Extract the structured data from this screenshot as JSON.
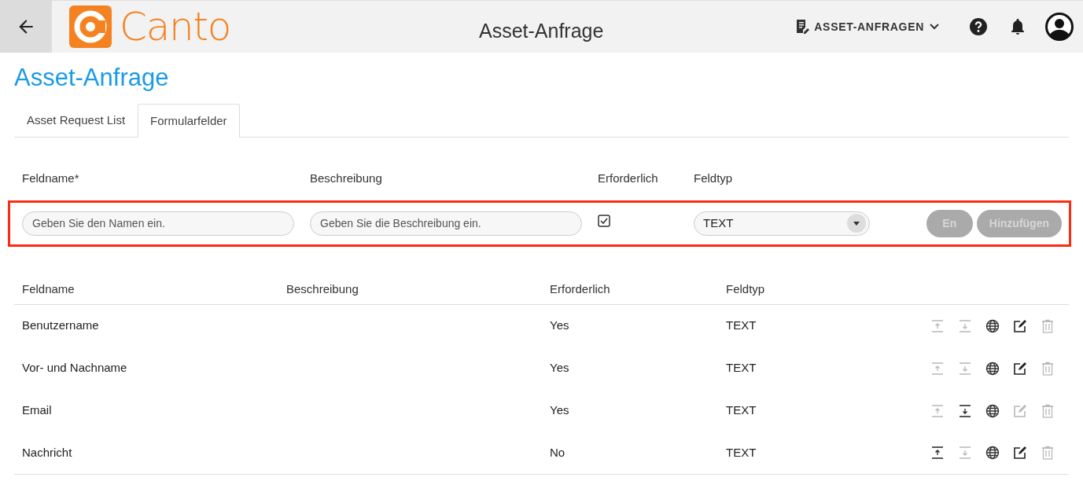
{
  "header": {
    "logo_text": "Canto",
    "title": "Asset-Anfrage",
    "menu_label": "ASSET-ANFRAGEN"
  },
  "page_title": "Asset-Anfrage",
  "tabs": [
    {
      "label": "Asset Request List",
      "selected": false
    },
    {
      "label": "Formularfelder",
      "selected": true
    }
  ],
  "form": {
    "labels": [
      "Feldname*",
      "Beschreibung",
      "Erforderlich",
      "Feldtyp"
    ],
    "name_placeholder": "Geben Sie den Namen ein.",
    "description_placeholder": "Geben Sie die Beschreibung ein.",
    "required_checked": true,
    "type_value": "TEXT",
    "buttons": [
      {
        "label": "En",
        "disabled": true
      },
      {
        "label": "Hinzufügen",
        "disabled": true
      }
    ]
  },
  "table": {
    "columns": [
      "Feldname",
      "Beschreibung",
      "Erforderlich",
      "Feldtyp"
    ],
    "rows": [
      {
        "name": "Benutzername",
        "required": "Yes",
        "type": "TEXT",
        "up_enabled": false,
        "down_enabled": false,
        "edit_enabled": true,
        "delete_enabled": false
      },
      {
        "name": "Vor- und Nachname",
        "required": "Yes",
        "type": "TEXT",
        "up_enabled": false,
        "down_enabled": false,
        "edit_enabled": true,
        "delete_enabled": false
      },
      {
        "name": "Email",
        "required": "Yes",
        "type": "TEXT",
        "up_enabled": false,
        "down_enabled": true,
        "edit_enabled": false,
        "delete_enabled": false
      },
      {
        "name": "Nachricht",
        "required": "No",
        "type": "TEXT",
        "up_enabled": true,
        "down_enabled": false,
        "edit_enabled": true,
        "delete_enabled": false
      }
    ]
  }
}
